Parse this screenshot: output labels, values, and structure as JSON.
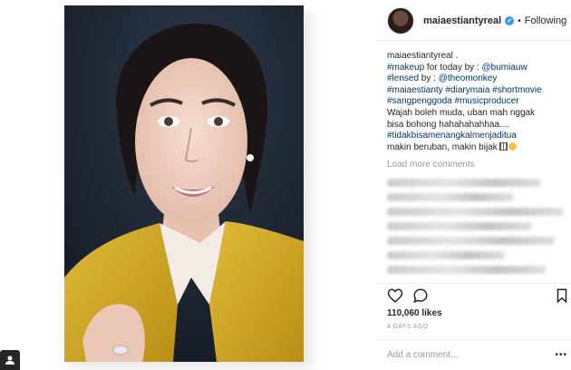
{
  "post": {
    "username": "maiaestiantyreal",
    "follow_status": "Following",
    "dot": "•",
    "caption": {
      "author": "maiaestiantyreal",
      "author_suffix": " .",
      "line2_tag": "#makeup",
      "line2_text": " for today by : ",
      "line2_mention": "@bumiauw",
      "line3_tag": "#lensed",
      "line3_text": " by : ",
      "line3_mention": "@theomonkey",
      "line4": "#maiaestianty #diarymaia #shortmovie",
      "line5": "#sangpenggoda #musicproducer",
      "line6": "Wajah boleh muda, uban mah nggak",
      "line7": "bisa bohong hahahahahhaa....",
      "line8": "#tidakbisamenangkalmenjaditua",
      "line9": "makin beruban, makin bijak"
    },
    "load_more": "Load more comments",
    "likes": "110,060 likes",
    "time": "4 DAYS AGO",
    "comment_placeholder": "Add a comment...",
    "more": "•••"
  },
  "colors": {
    "link": "#003569",
    "muted": "#999999",
    "verified": "#3897f0",
    "jacket": "#d9b12a",
    "background_photo": "#1d2430"
  },
  "icons": {
    "verified": "verified-badge-icon",
    "like": "heart-icon",
    "comment": "comment-bubble-icon",
    "save": "bookmark-icon",
    "user": "user-icon",
    "more": "more-options-icon"
  }
}
